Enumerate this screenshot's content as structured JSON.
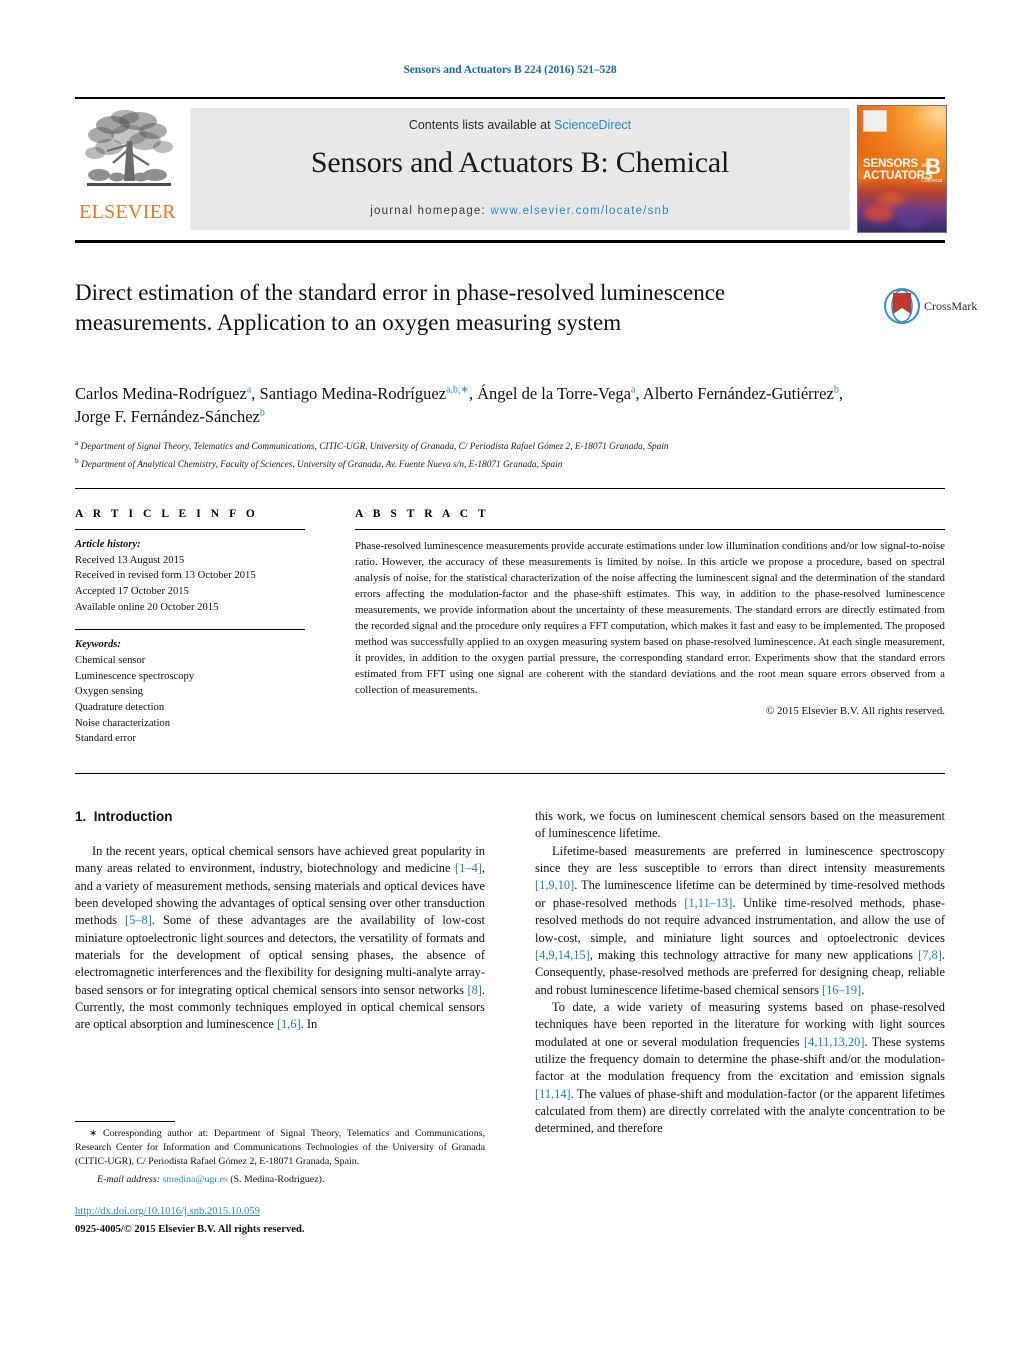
{
  "running_head": "Sensors and Actuators B 224 (2016) 521–528",
  "masthead": {
    "publisher_logo_text": "ELSEVIER",
    "contents_prefix": "Contents lists available at ",
    "contents_link": "ScienceDirect",
    "journal_title": "Sensors and Actuators B: Chemical",
    "homepage_label": "journal homepage: ",
    "homepage_url": "www.elsevier.com/locate/snb",
    "cover": {
      "line1": "SENSORS",
      "line1_small": "and",
      "line2": "ACTUATORS",
      "letter": "B",
      "letter_sub": "Chemical"
    }
  },
  "crossmark": {
    "label": "CrossMark"
  },
  "article": {
    "title": "Direct estimation of the standard error in phase-resolved luminescence measurements. Application to an oxygen measuring system",
    "authors": [
      {
        "name": "Carlos Medina-Rodríguez",
        "marks": "a"
      },
      {
        "name": "Santiago Medina-Rodríguez",
        "marks": "a,b,∗"
      },
      {
        "name": "Ángel de la Torre-Vega",
        "marks": "a"
      },
      {
        "name": "Alberto Fernández-Gutiérrez",
        "marks": "b"
      },
      {
        "name": "Jorge F. Fernández-Sánchez",
        "marks": "b"
      }
    ],
    "affiliations": [
      {
        "mark": "a",
        "text": "Department of Signal Theory, Telematics and Communications, CITIC-UGR, University of Granada, C/ Periodista Rafael Gómez 2, E-18071 Granada, Spain"
      },
      {
        "mark": "b",
        "text": "Department of Analytical Chemistry, Faculty of Sciences, University of Granada, Av. Fuente Nueva s/n, E-18071 Granada, Spain"
      }
    ]
  },
  "article_info": {
    "heading": "A R T I C L E   I N F O",
    "history_label": "Article history:",
    "history": [
      "Received 13 August 2015",
      "Received in revised form 13 October 2015",
      "Accepted 17 October 2015",
      "Available online 20 October 2015"
    ],
    "keywords_label": "Keywords:",
    "keywords": [
      "Chemical sensor",
      "Luminescence spectroscopy",
      "Oxygen sensing",
      "Quadrature detection",
      "Noise characterization",
      "Standard error"
    ]
  },
  "abstract": {
    "heading": "A B S T R A C T",
    "text": "Phase-resolved luminescence measurements provide accurate estimations under low illumination conditions and/or low signal-to-noise ratio. However, the accuracy of these measurements is limited by noise. In this article we propose a procedure, based on spectral analysis of noise, for the statistical characterization of the noise affecting the luminescent signal and the determination of the standard errors affecting the modulation-factor and the phase-shift estimates. This way, in addition to the phase-resolved luminescence measurements, we provide information about the uncertainty of these measurements. The standard errors are directly estimated from the recorded signal and the procedure only requires a FFT computation, which makes it fast and easy to be implemented. The proposed method was successfully applied to an oxygen measuring system based on phase-resolved luminescence. At each single measurement, it provides, in addition to the oxygen partial pressure, the corresponding standard error. Experiments show that the standard errors estimated from FFT using one signal are coherent with the standard deviations and the root mean square errors observed from a collection of measurements.",
    "copyright": "© 2015 Elsevier B.V. All rights reserved."
  },
  "body": {
    "section_number": "1.",
    "section_title": "Introduction",
    "left_paragraphs": [
      "In the recent years, optical chemical sensors have achieved great popularity in many areas related to environment, industry, biotechnology and medicine [1–4], and a variety of measurement methods, sensing materials and optical devices have been developed showing the advantages of optical sensing over other transduction methods [5–8]. Some of these advantages are the availability of low-cost miniature optoelectronic light sources and detectors, the versatility of formats and materials for the development of optical sensing phases, the absence of electromagnetic interferences and the flexibility for designing multi-analyte array-based sensors or for integrating optical chemical sensors into sensor networks [8]. Currently, the most commonly techniques employed in optical chemical sensors are optical absorption and luminescence [1,6]. In"
    ],
    "right_paragraphs": [
      "this work, we focus on luminescent chemical sensors based on the measurement of luminescence lifetime.",
      "Lifetime-based measurements are preferred in luminescence spectroscopy since they are less susceptible to errors than direct intensity measurements [1,9,10]. The luminescence lifetime can be determined by time-resolved methods or phase-resolved methods [1,11–13]. Unlike time-resolved methods, phase-resolved methods do not require advanced instrumentation, and allow the use of low-cost, simple, and miniature light sources and optoelectronic devices [4,9,14,15], making this technology attractive for many new applications [7,8]. Consequently, phase-resolved methods are preferred for designing cheap, reliable and robust luminescence lifetime-based chemical sensors [16–19].",
      "To date, a wide variety of measuring systems based on phase-resolved techniques have been reported in the literature for working with light sources modulated at one or several modulation frequencies [4,11,13,20]. These systems utilize the frequency domain to determine the phase-shift and/or the modulation-factor at the modulation frequency from the excitation and emission signals [11,14]. The values of phase-shift and modulation-factor (or the apparent lifetimes calculated from them) are directly correlated with the analyte concentration to be determined, and therefore"
    ]
  },
  "footnote": {
    "text": "∗ Corresponding author at: Department of Signal Theory, Telematics and Communications, Research Center for Information and Communications Technologies of the University of Granada (CITIC-UGR), C/ Periodista Rafael Gómez 2, E-18071 Granada, Spain.",
    "email_label": "E-mail address:",
    "email": "smedina@ugr.es",
    "email_suffix": "(S. Medina-Rodríguez)."
  },
  "footer": {
    "doi": "http://dx.doi.org/10.1016/j.snb.2015.10.059",
    "issn_line": "0925-4005/© 2015 Elsevier B.V. All rights reserved."
  },
  "colors": {
    "link": "#2a8bc4",
    "reference": "#1a7fb5",
    "elsevier_orange": "#E87722",
    "banner_bg": "#e8e8e8"
  }
}
